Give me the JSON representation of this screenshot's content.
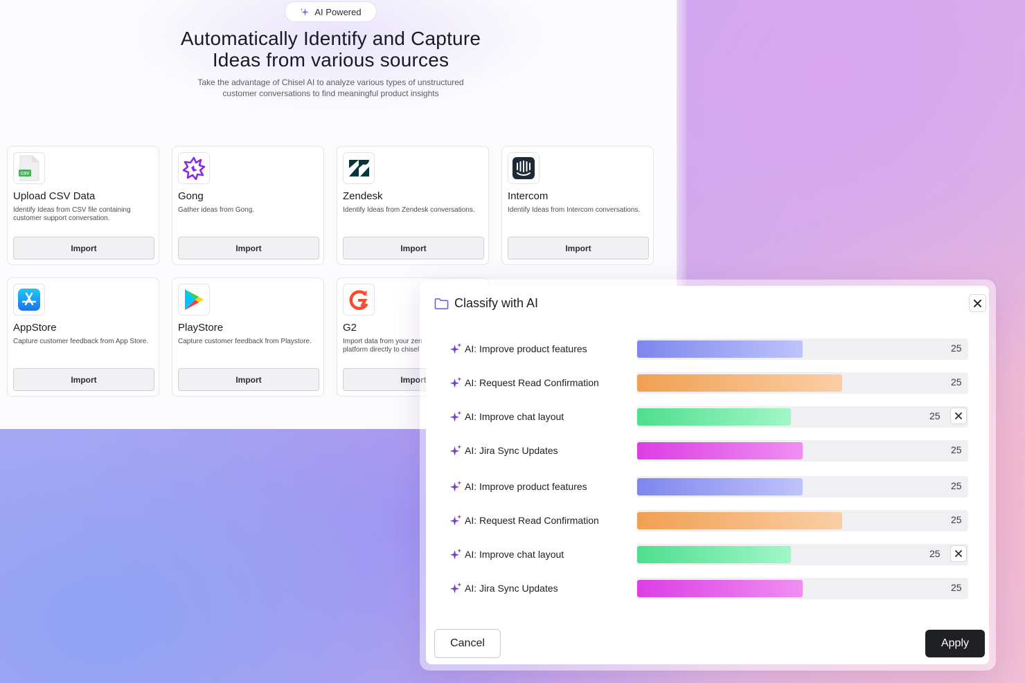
{
  "hero": {
    "badge": "AI Powered",
    "title_line1": "Automatically Identify and Capture",
    "title_line2": "Ideas from various sources",
    "subtitle_line1": "Take the advantage of Chisel AI to analyze various types of unstructured",
    "subtitle_line2": "customer conversations to find meaningful product insights"
  },
  "sources": [
    {
      "title": "Upload CSV Data",
      "desc": "Identify Ideas from CSV file containing customer support conversation.",
      "button": "Import",
      "icon": "csv-file-icon"
    },
    {
      "title": "Gong",
      "desc": "Gather ideas from Gong.",
      "button": "Import",
      "icon": "gong-logo"
    },
    {
      "title": "Zendesk",
      "desc": "Identify Ideas from Zendesk conversations.",
      "button": "Import",
      "icon": "zendesk-logo"
    },
    {
      "title": "Intercom",
      "desc": "Identify Ideas from Intercom conversations.",
      "button": "Import",
      "icon": "intercom-logo"
    },
    {
      "title": "AppStore",
      "desc": "Capture customer feedback from App Store.",
      "button": "Import",
      "icon": "appstore-logo"
    },
    {
      "title": "PlayStore",
      "desc": "Capture customer feedback from Playstore.",
      "button": "Import",
      "icon": "playstore-logo"
    },
    {
      "title": "G2",
      "desc_line1": "Import data from your zen",
      "desc_line2": "platform directly to chisel",
      "button": "Import",
      "icon": "g2-logo"
    }
  ],
  "modal": {
    "title": "Classify with AI",
    "cancel": "Cancel",
    "apply": "Apply",
    "rows": [
      {
        "label": "AI: Improve product features",
        "count": "25",
        "fraction": 0.5,
        "gradient": [
          "#7d86ec",
          "#bfc4fb"
        ]
      },
      {
        "label": "AI: Request Read Confirmation",
        "count": "25",
        "fraction": 0.62,
        "gradient": [
          "#f0a052",
          "#fbcfa6"
        ]
      },
      {
        "label": "AI: Improve chat layout",
        "count": "25",
        "fraction": 0.465,
        "gradient": [
          "#4fde8e",
          "#a1f7c8"
        ],
        "removable": true
      },
      {
        "label": "AI: Jira Sync Updates",
        "count": "25",
        "fraction": 0.5,
        "gradient": [
          "#dc3ee4",
          "#ef8ef2"
        ]
      },
      {
        "label": "AI: Improve product features",
        "count": "25",
        "fraction": 0.5,
        "gradient": [
          "#7d86ec",
          "#bfc4fb"
        ]
      },
      {
        "label": "AI: Request Read Confirmation",
        "count": "25",
        "fraction": 0.62,
        "gradient": [
          "#f0a052",
          "#fbcfa6"
        ]
      },
      {
        "label": "AI: Improve chat layout",
        "count": "25",
        "fraction": 0.465,
        "gradient": [
          "#4fde8e",
          "#a1f7c8"
        ],
        "removable": true
      },
      {
        "label": "AI: Jira Sync Updates",
        "count": "25",
        "fraction": 0.5,
        "gradient": [
          "#dc3ee4",
          "#ef8ef2"
        ]
      }
    ]
  },
  "colors": {
    "accent": "#7a3fd0",
    "apply_bg": "#1e2024"
  }
}
